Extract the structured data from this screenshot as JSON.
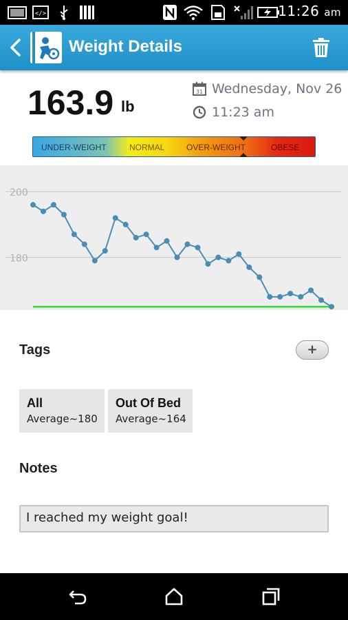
{
  "status_bar": {
    "time": "11:26",
    "ampm": "am"
  },
  "app_bar": {
    "title": "Weight Details"
  },
  "entry": {
    "weight": "163.9",
    "unit": "lb",
    "date": "Wednesday, Nov 26",
    "time": "11:23 am"
  },
  "bmi_scale": {
    "labels": [
      "UNDER-WEIGHT",
      "NORMAL",
      "OVER-WEIGHT",
      "OBESE"
    ],
    "label_colors": [
      "#1b3a66",
      "#7a5a00",
      "#6a2a00",
      "#6a0a05"
    ],
    "current_category": "OVER-WEIGHT"
  },
  "chart_data": {
    "type": "line",
    "y_ticks": [
      200,
      180
    ],
    "ylim": [
      164,
      208
    ],
    "goal": 165,
    "goal_color": "#2ee32e",
    "line_color": "#4a8db4",
    "values": [
      196,
      194,
      196,
      193,
      187,
      184,
      179,
      182,
      192,
      190,
      186,
      187,
      183,
      185,
      180,
      184,
      183,
      178,
      180,
      179,
      181,
      177,
      174,
      168,
      168,
      169,
      168,
      170,
      167,
      165
    ]
  },
  "tags": {
    "title": "Tags",
    "add_label": "+",
    "items": [
      {
        "name": "All",
        "average": "Average~180"
      },
      {
        "name": "Out Of Bed",
        "average": "Average~164"
      }
    ]
  },
  "notes": {
    "title": "Notes",
    "value": "I reached my weight goal!"
  }
}
